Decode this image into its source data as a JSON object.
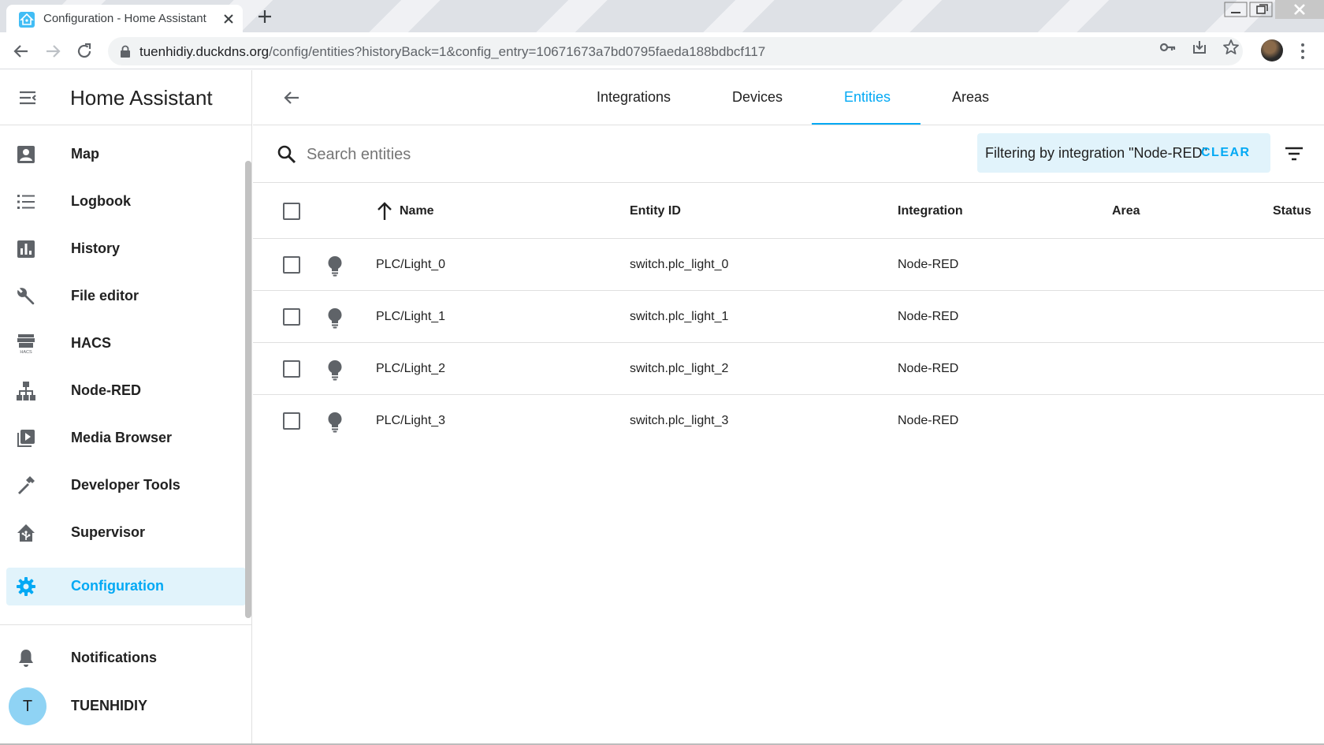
{
  "browser": {
    "tab_title": "Configuration - Home Assistant",
    "url_host": "tuenhidiy.duckdns.org",
    "url_path": "/config/entities?historyBack=1&config_entry=10671673a7bd0795faeda188bdbcf117"
  },
  "app": {
    "title": "Home Assistant",
    "accent_color": "#03a9f4"
  },
  "sidebar": {
    "items": [
      {
        "label": "Map",
        "icon": "account-box-icon"
      },
      {
        "label": "Logbook",
        "icon": "format-list-icon"
      },
      {
        "label": "History",
        "icon": "chart-box-icon"
      },
      {
        "label": "File editor",
        "icon": "wrench-icon"
      },
      {
        "label": "HACS",
        "icon": "hacs-icon"
      },
      {
        "label": "Node-RED",
        "icon": "sitemap-icon"
      },
      {
        "label": "Media Browser",
        "icon": "play-box-multiple-icon"
      },
      {
        "label": "Developer Tools",
        "icon": "hammer-icon"
      },
      {
        "label": "Supervisor",
        "icon": "home-assistant-icon"
      },
      {
        "label": "Configuration",
        "icon": "cog-icon",
        "active": true
      }
    ],
    "notifications_label": "Notifications",
    "user": {
      "initial": "T",
      "name": "TUENHIDIY"
    }
  },
  "tabs": [
    {
      "label": "Integrations"
    },
    {
      "label": "Devices"
    },
    {
      "label": "Entities",
      "active": true
    },
    {
      "label": "Areas"
    }
  ],
  "search": {
    "placeholder": "Search entities"
  },
  "filter": {
    "text": "Filtering by integration \"Node-RED\"",
    "clear_label": "CLEAR"
  },
  "table": {
    "columns": [
      "Name",
      "Entity ID",
      "Integration",
      "Area",
      "Status"
    ],
    "rows": [
      {
        "name": "PLC/Light_0",
        "entity_id": "switch.plc_light_0",
        "integration": "Node-RED",
        "area": "",
        "status": ""
      },
      {
        "name": "PLC/Light_1",
        "entity_id": "switch.plc_light_1",
        "integration": "Node-RED",
        "area": "",
        "status": ""
      },
      {
        "name": "PLC/Light_2",
        "entity_id": "switch.plc_light_2",
        "integration": "Node-RED",
        "area": "",
        "status": ""
      },
      {
        "name": "PLC/Light_3",
        "entity_id": "switch.plc_light_3",
        "integration": "Node-RED",
        "area": "",
        "status": ""
      }
    ]
  }
}
